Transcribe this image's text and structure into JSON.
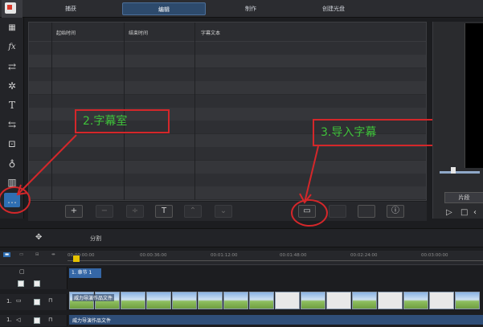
{
  "tabs": [
    {
      "label": "捕获",
      "active": false
    },
    {
      "label": "编辑",
      "active": true
    },
    {
      "label": "制作",
      "active": false
    },
    {
      "label": "创建光盘",
      "active": false
    }
  ],
  "tools": [
    "media-icon",
    "fx-icon",
    "overlay-icon",
    "particle-icon",
    "title-icon",
    "transition-icon",
    "pip-icon",
    "microphone-icon",
    "chapter-icon",
    "subtitle-icon"
  ],
  "tool_glyphs": [
    "▦",
    "fx",
    "⇄",
    "✲",
    "T",
    "⇆",
    "⊡",
    "♁",
    "▥",
    "…"
  ],
  "subtitle_table": {
    "columns": [
      "起始时间",
      "结束时间",
      "字幕文本"
    ],
    "row_count": 12
  },
  "panel_toolbar": {
    "add": "+",
    "remove": "−",
    "merge": "÷",
    "text": "T",
    "up": "⌃",
    "down": "⌄",
    "import": "▭",
    "info": "ⓘ"
  },
  "annotations": {
    "callout_subtitle_room": "2.字幕室",
    "callout_import": "3.导入字幕",
    "color": "#d4272a",
    "text_color": "#3fc13a"
  },
  "preview": {
    "clip_button": "片段"
  },
  "split_bar": {
    "label": "分割"
  },
  "timeline": {
    "ticks": [
      "00:00:00:00",
      "00:00:36:00",
      "00:01:12:00",
      "00:01:48:00",
      "00:02:24:00",
      "00:03:00:00"
    ],
    "subtitle_clip": "1. 章节 1",
    "video_clip": "威力导演作品文件",
    "audio_clip": "威力导演作品文件",
    "track_labels": [
      "1.",
      "1."
    ]
  }
}
